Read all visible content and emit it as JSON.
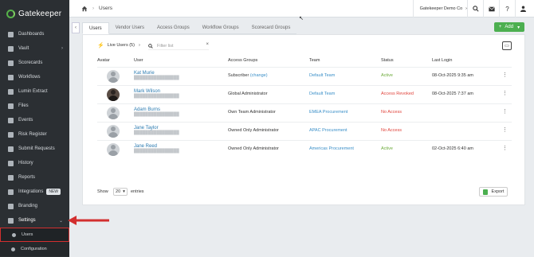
{
  "app": {
    "name": "Gatekeeper"
  },
  "sidebar": {
    "items": [
      {
        "label": "Dashboards",
        "icon": "dashboard-icon"
      },
      {
        "label": "Vault",
        "icon": "vault-icon",
        "expandable": true
      },
      {
        "label": "Scorecards",
        "icon": "scorecard-icon"
      },
      {
        "label": "Workflows",
        "icon": "workflow-icon"
      },
      {
        "label": "Lumin Extract",
        "icon": "lumin-icon"
      },
      {
        "label": "Files",
        "icon": "files-icon"
      },
      {
        "label": "Events",
        "icon": "events-icon"
      },
      {
        "label": "Risk Register",
        "icon": "risk-icon"
      },
      {
        "label": "Submit Requests",
        "icon": "submit-icon"
      },
      {
        "label": "History",
        "icon": "history-icon"
      },
      {
        "label": "Reports",
        "icon": "reports-icon"
      },
      {
        "label": "Integrations",
        "icon": "integrations-icon",
        "badge": "NEW"
      },
      {
        "label": "Branding",
        "icon": "branding-icon"
      },
      {
        "label": "Settings",
        "icon": "gear-icon",
        "expanded": true
      }
    ],
    "sub_items": [
      {
        "label": "Users",
        "icon": "user-icon",
        "active": true
      },
      {
        "label": "Configuration",
        "icon": "config-icon"
      }
    ]
  },
  "topbar": {
    "breadcrumb": "Users",
    "org": "Gatekeeper Demo Co"
  },
  "tabs": [
    "Users",
    "Vendor Users",
    "Access Groups",
    "Workflow Groups",
    "Scorecard Groups"
  ],
  "add_button": "Add",
  "toolbar": {
    "live_users": "Live Users (5)",
    "filter_placeholder": "Filter list"
  },
  "table": {
    "headers": [
      "Avatar",
      "User",
      "Access Groups",
      "Team",
      "Status",
      "Last Login"
    ],
    "rows": [
      {
        "name": "Kat Murie",
        "avatar": "placeholder",
        "access": "Subscriber",
        "access_link": "(change)",
        "team": "Default Team",
        "status": "Active",
        "status_color": "#6dab3b",
        "last_login": "08-Oct-2025 9:35 am"
      },
      {
        "name": "Mark Wilson",
        "avatar": "photo",
        "access": "Global Administrator",
        "access_link": "",
        "team": "Default Team",
        "status": "Access Revoked",
        "status_color": "#e0433b",
        "last_login": "08-Oct-2025 7:37 am"
      },
      {
        "name": "Adam Burns",
        "avatar": "placeholder",
        "access": "Own Team Administrator",
        "access_link": "",
        "team": "EMEA Procurement",
        "status": "No Access",
        "status_color": "#e0433b",
        "last_login": ""
      },
      {
        "name": "Jane Taylor",
        "avatar": "placeholder",
        "access": "Owned Only Administrator",
        "access_link": "",
        "team": "APAC Procurement",
        "status": "No Access",
        "status_color": "#e0433b",
        "last_login": ""
      },
      {
        "name": "Jane Reed",
        "avatar": "placeholder",
        "access": "Owned Only Administrator",
        "access_link": "",
        "team": "Americas Procurement",
        "status": "Active",
        "status_color": "#6dab3b",
        "last_login": "02-Oct-2025 6:40 am"
      }
    ]
  },
  "footer": {
    "show": "Show",
    "page_size": "20",
    "entries": "entries",
    "export": "Export"
  },
  "colors": {
    "sidebar": "#2b2f33",
    "accent": "#4caf50",
    "link": "#2a7ab0",
    "highlight": "#d32f2f"
  }
}
